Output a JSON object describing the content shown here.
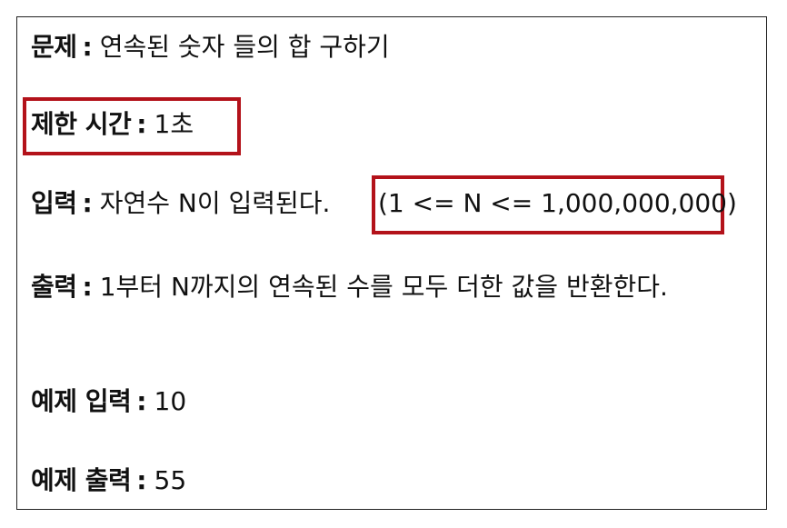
{
  "problem": {
    "label": "문제",
    "colon": ":",
    "value": "연속된 숫자 들의 합 구하기"
  },
  "time_limit": {
    "label": "제한 시간",
    "colon": ":",
    "value": "1초"
  },
  "input": {
    "label": "입력",
    "colon": ":",
    "value": "자연수 N이 입력된다.",
    "constraint": "(1 <= N <= 1,000,000,000)"
  },
  "output": {
    "label": "출력",
    "colon": ":",
    "value": "1부터 N까지의 연속된 수를 모두 더한 값을 반환한다."
  },
  "example_input": {
    "label": "예제 입력",
    "colon": ":",
    "value": "10"
  },
  "example_output": {
    "label": "예제 출력",
    "colon": ":",
    "value": "55"
  },
  "highlight_color": "#b3121a"
}
